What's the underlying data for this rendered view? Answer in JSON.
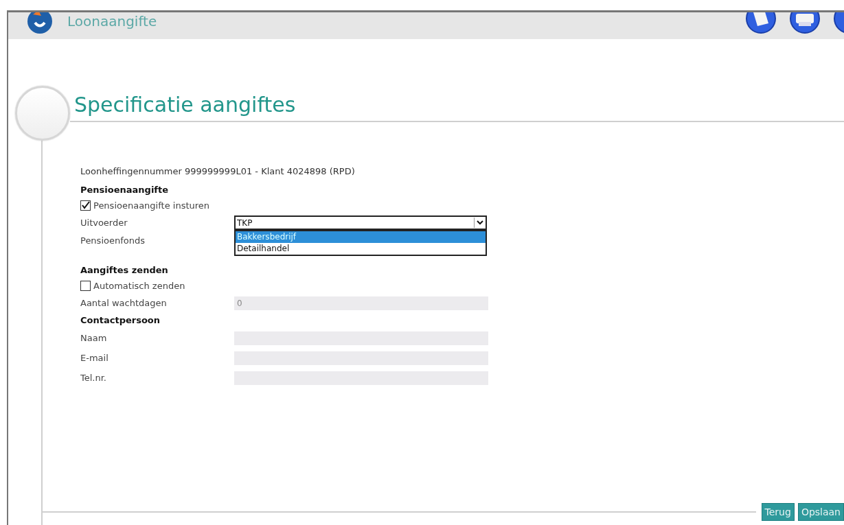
{
  "header": {
    "title": "Loonaangifte"
  },
  "page_title": "Specificatie aangiftes",
  "info_line": "Loonheffingennummer 999999999L01 - Klant 4024898 (RPD)",
  "sections": [
    {
      "heading": "Pensioenaangifte",
      "rows": [
        {
          "kind": "checkbox",
          "label": "Pensioenaangifte insturen",
          "checked": true
        },
        {
          "kind": "select",
          "label": "Uitvoerder",
          "value": "TKP"
        },
        {
          "kind": "listbox",
          "label": "Pensioenfonds",
          "options": [
            {
              "label": "Bakkersbedrijf",
              "selected": true
            },
            {
              "label": "Detailhandel",
              "selected": false
            }
          ]
        }
      ]
    },
    {
      "heading": "Aangiftes zenden",
      "rows": [
        {
          "kind": "checkbox",
          "label": "Automatisch zenden",
          "checked": false
        },
        {
          "kind": "field",
          "label": "Aantal wachtdagen",
          "value": "0",
          "disabled": true
        }
      ]
    },
    {
      "heading": "Contactpersoon",
      "rows": [
        {
          "kind": "field",
          "label": "Naam",
          "disabled": true
        },
        {
          "kind": "field",
          "label": "E-mail",
          "disabled": true
        },
        {
          "kind": "field",
          "label": "Tel.nr.",
          "disabled": true
        }
      ]
    }
  ],
  "buttons": [
    "Terug",
    "Opslaan"
  ]
}
